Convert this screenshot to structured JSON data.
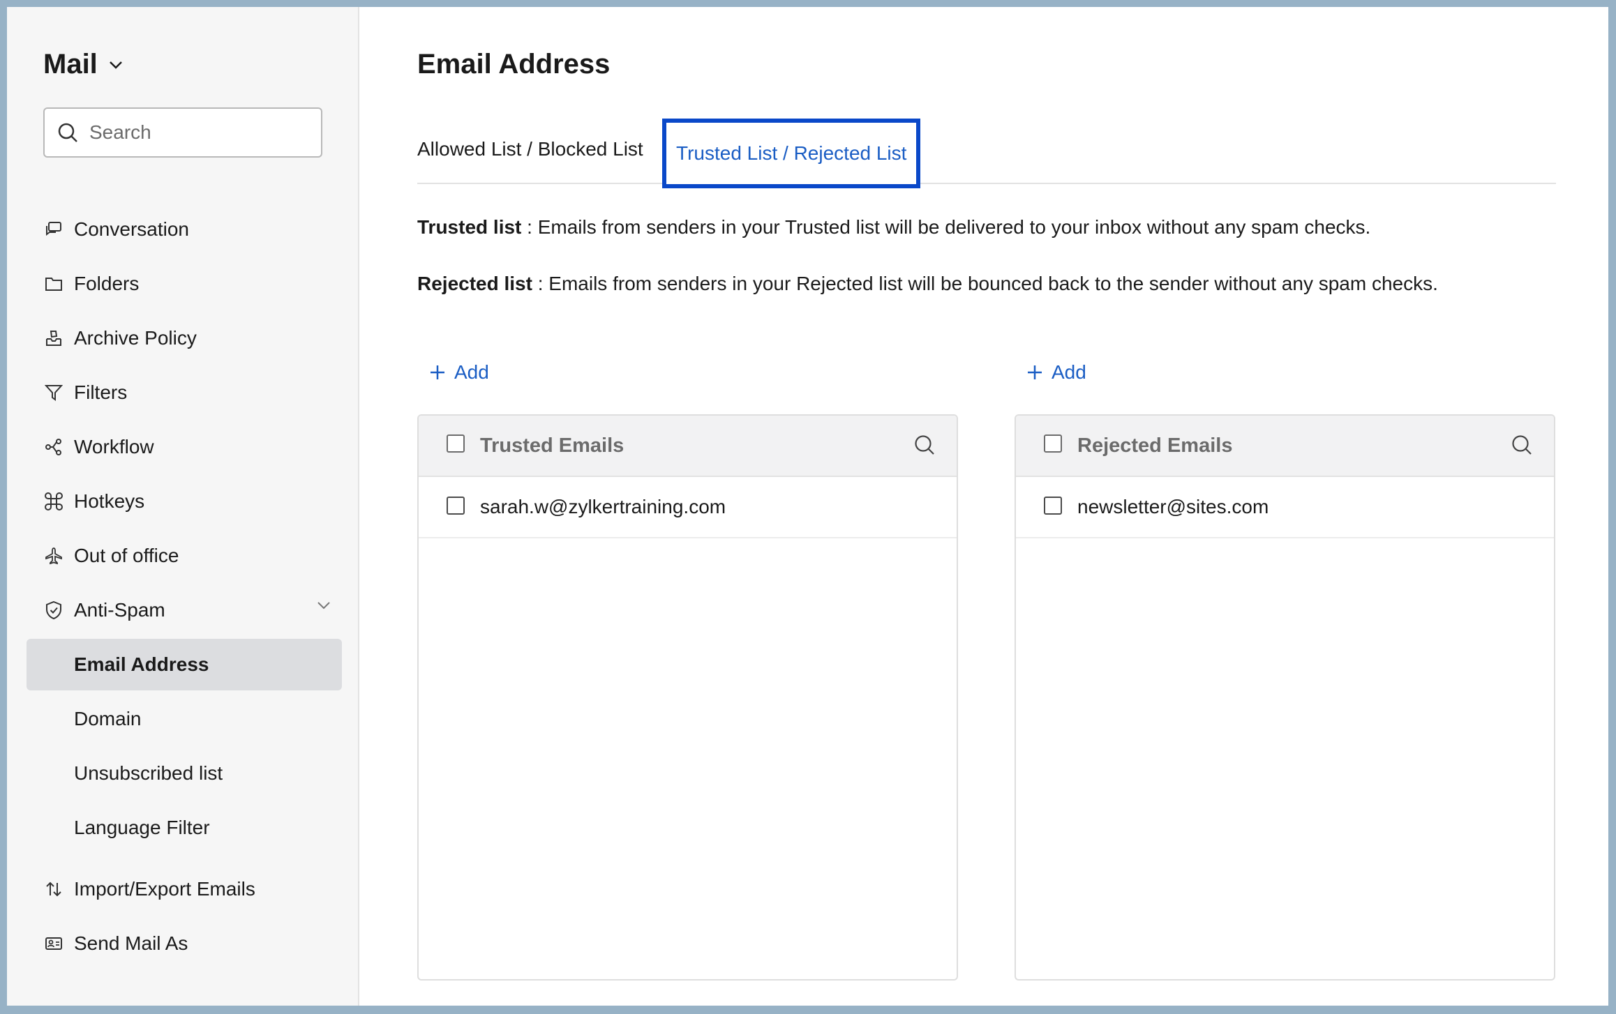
{
  "sidebar": {
    "app_title": "Mail",
    "search_placeholder": "Search",
    "items": [
      {
        "label": "Conversation",
        "icon": "conversation-icon"
      },
      {
        "label": "Folders",
        "icon": "folder-icon"
      },
      {
        "label": "Archive Policy",
        "icon": "archive-icon"
      },
      {
        "label": "Filters",
        "icon": "filter-icon"
      },
      {
        "label": "Workflow",
        "icon": "workflow-icon"
      },
      {
        "label": "Hotkeys",
        "icon": "command-key-icon"
      },
      {
        "label": "Out of office",
        "icon": "airplane-icon"
      },
      {
        "label": "Anti-Spam",
        "icon": "shield-check-icon"
      },
      {
        "label": "Email Address"
      },
      {
        "label": "Domain"
      },
      {
        "label": "Unsubscribed list"
      },
      {
        "label": "Language Filter"
      },
      {
        "label": "Import/Export Emails",
        "icon": "import-export-icon"
      },
      {
        "label": "Send Mail As",
        "icon": "send-mail-as-icon"
      }
    ]
  },
  "main": {
    "title": "Email Address",
    "tabs": [
      {
        "label": "Allowed List / Blocked List"
      },
      {
        "label": "Trusted List / Rejected List"
      }
    ],
    "descriptions": {
      "trusted_term": "Trusted list",
      "trusted_text": " : Emails from senders in your Trusted list will be delivered to your inbox without any spam checks.",
      "rejected_term": "Rejected list",
      "rejected_text": " : Emails from senders in your Rejected list will be bounced back to the sender without any spam checks."
    },
    "add_label": "Add",
    "trusted_panel": {
      "header": "Trusted Emails",
      "rows": [
        "sarah.w@zylkertraining.com"
      ]
    },
    "rejected_panel": {
      "header": "Rejected Emails",
      "rows": [
        "newsletter@sites.com"
      ]
    }
  },
  "colors": {
    "accent": "#1a5dc4",
    "tab_highlight_border": "#0a48c9",
    "active_nav_bg": "#dcdde0"
  }
}
